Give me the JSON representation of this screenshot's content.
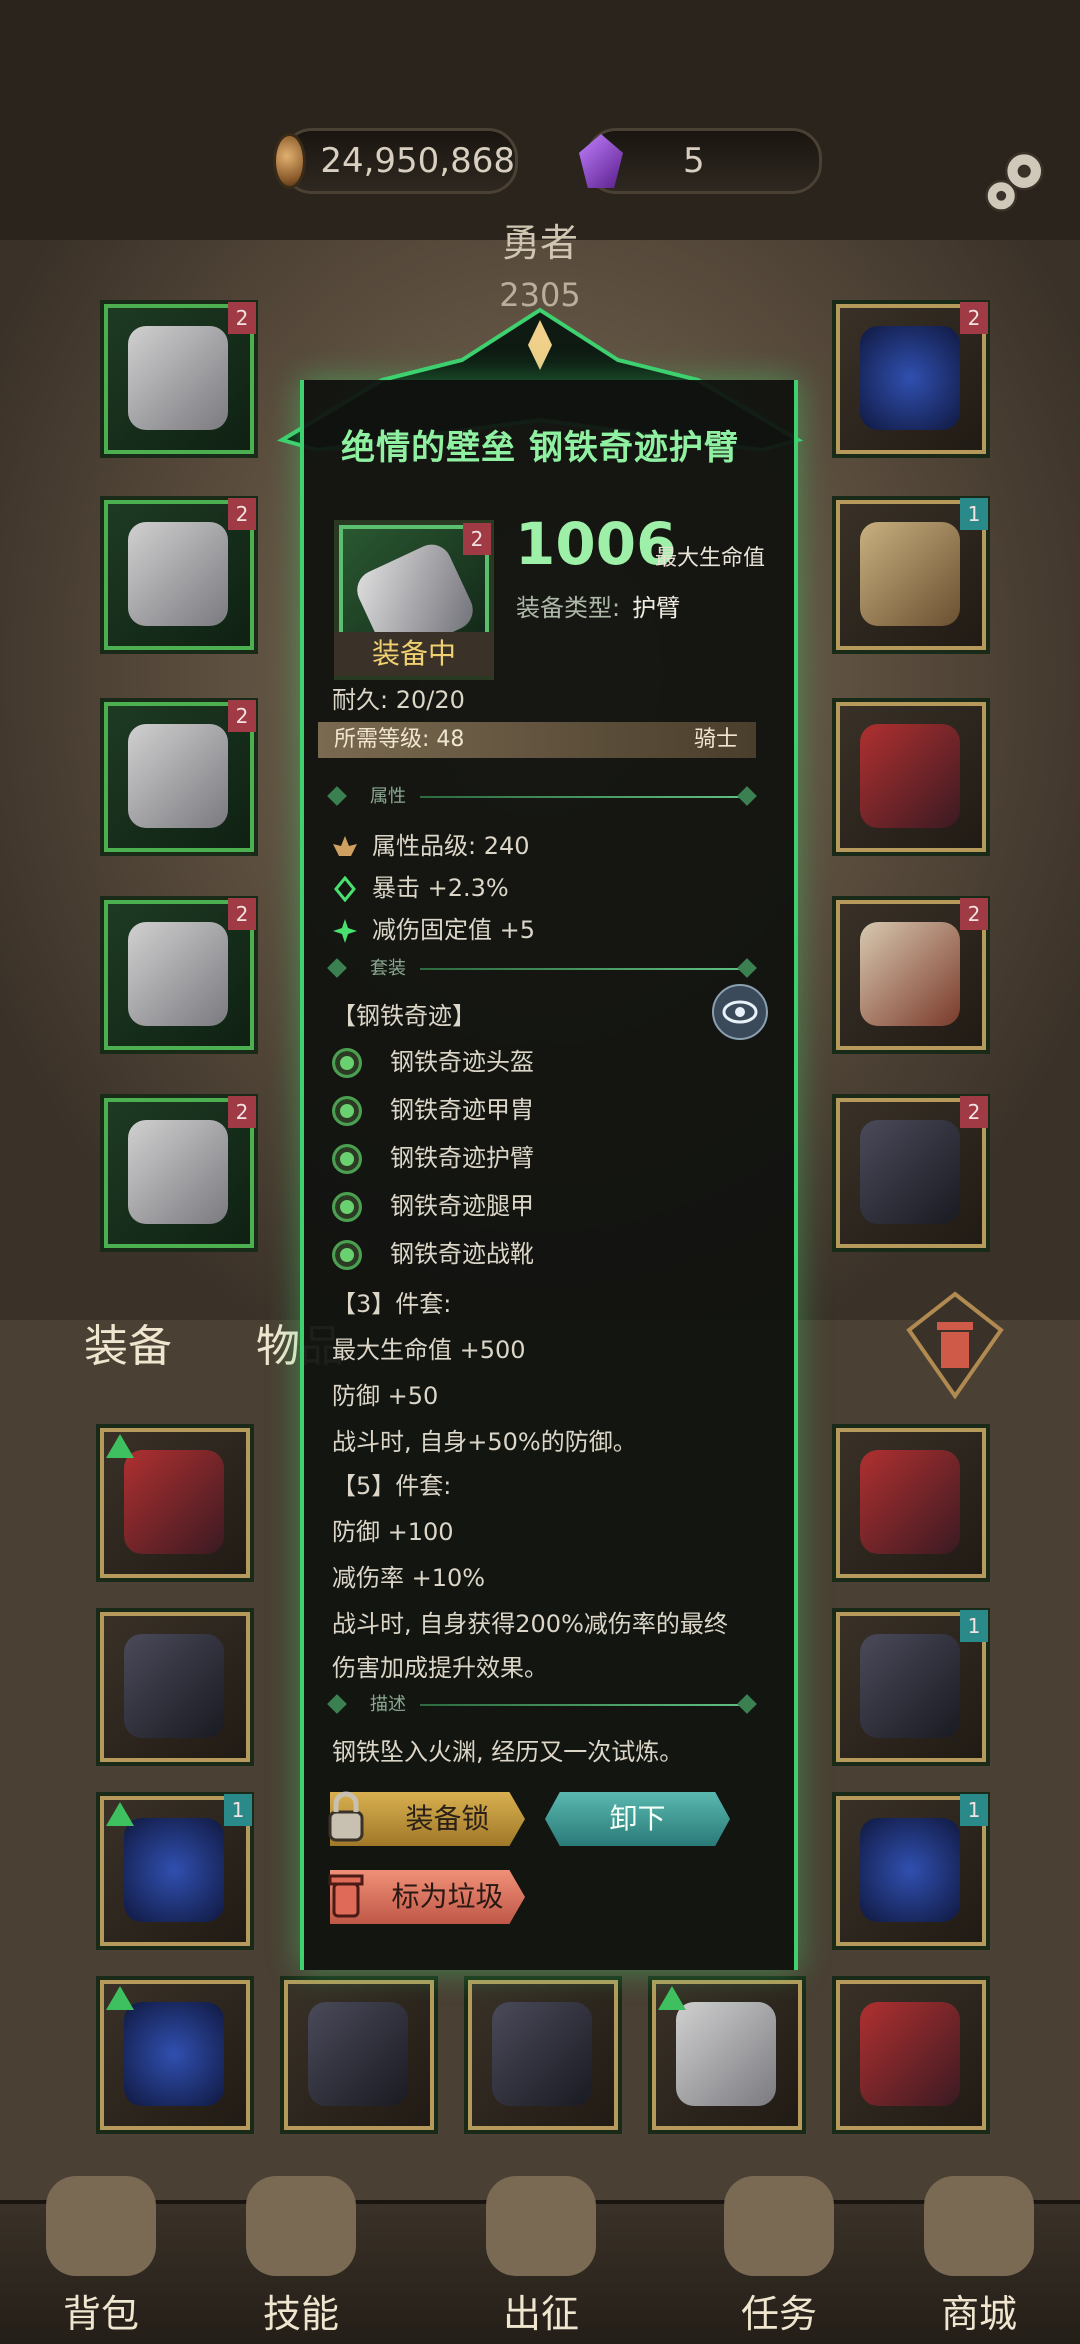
{
  "resources": {
    "gold_icon": "coin-icon",
    "gold": "24,950,868",
    "gem_icon": "purple-crystal-icon",
    "gems": "5"
  },
  "hero": {
    "name": "勇者",
    "number": "2305"
  },
  "item": {
    "title": "绝情的壁垒 钢铁奇迹护臂",
    "equipped_label": "装备中",
    "main_stat_value": "1006",
    "main_stat_label": "最大生命值",
    "type_label": "装备类型:",
    "type_value": "护臂",
    "durability": "耐久: 20/20",
    "required_level": "所需等级: 48",
    "class": "骑士",
    "section_attributes": "属性",
    "attr_grade": "属性品级: 240",
    "attr_crit": "暴击 +2.3%",
    "attr_reduction": "减伤固定值 +5",
    "section_set": "套装",
    "set_name": "【钢铁奇迹】",
    "set_pieces": [
      "钢铁奇迹头盔",
      "钢铁奇迹甲胄",
      "钢铁奇迹护臂",
      "钢铁奇迹腿甲",
      "钢铁奇迹战靴"
    ],
    "set3_header": "【3】件套:",
    "set3_lines": [
      "最大生命值 +500",
      "防御 +50",
      "战斗时, 自身+50%的防御。"
    ],
    "set5_header": "【5】件套:",
    "set5_lines": [
      "防御 +100",
      "减伤率 +10%",
      "战斗时, 自身获得200%减伤率的最终",
      "伤害加成提升效果。"
    ],
    "section_desc": "描述",
    "description": "钢铁坠入火渊, 经历又一次试炼。"
  },
  "buttons": {
    "lock": "装备锁",
    "unequip": "卸下",
    "mark_trash": "标为垃圾"
  },
  "tabs": {
    "equipment": "装备",
    "items": "物品"
  },
  "nav": [
    "背包",
    "技能",
    "出征",
    "任务",
    "商城"
  ],
  "colors": {
    "accent_green": "#3fd070",
    "stat_green": "#9ef0a8",
    "gold_button": "#d8b050",
    "teal_button": "#5ab8b0",
    "salmon_button": "#f09078"
  }
}
